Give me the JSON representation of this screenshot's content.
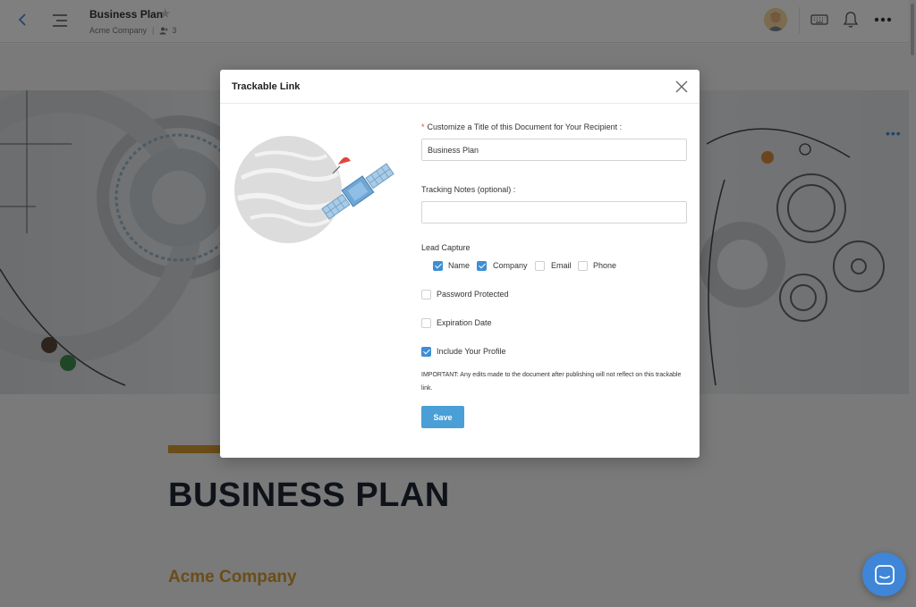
{
  "header": {
    "document_title": "Business Plan",
    "company": "Acme Company",
    "member_count": "3"
  },
  "document": {
    "heading": "BUSINESS PLAN",
    "company_name": "Acme Company",
    "more_dots": "•••"
  },
  "modal": {
    "title": "Trackable Link",
    "title_field": {
      "label": "Customize a Title of this Document for Your Recipient :",
      "required_mark": "*",
      "value": "Business Plan"
    },
    "notes_field": {
      "label": "Tracking Notes (optional) :",
      "value": ""
    },
    "lead_capture": {
      "label": "Lead Capture",
      "options": [
        {
          "label": "Name",
          "checked": true
        },
        {
          "label": "Company",
          "checked": true
        },
        {
          "label": "Email",
          "checked": false
        },
        {
          "label": "Phone",
          "checked": false
        }
      ]
    },
    "password_protected": {
      "label": "Password Protected",
      "checked": false
    },
    "expiration_date": {
      "label": "Expiration Date",
      "checked": false
    },
    "include_profile": {
      "label": "Include Your Profile",
      "checked": true
    },
    "important_note": "IMPORTANT: Any edits made to the document after publishing will not reflect on this trackable link.",
    "save_label": "Save"
  },
  "colors": {
    "accent_blue": "#4a9fd6",
    "checkbox_blue": "#3d8fd4",
    "gold": "#d49a2e",
    "heading_dark": "#1f2732",
    "required_red": "#e0453c"
  }
}
